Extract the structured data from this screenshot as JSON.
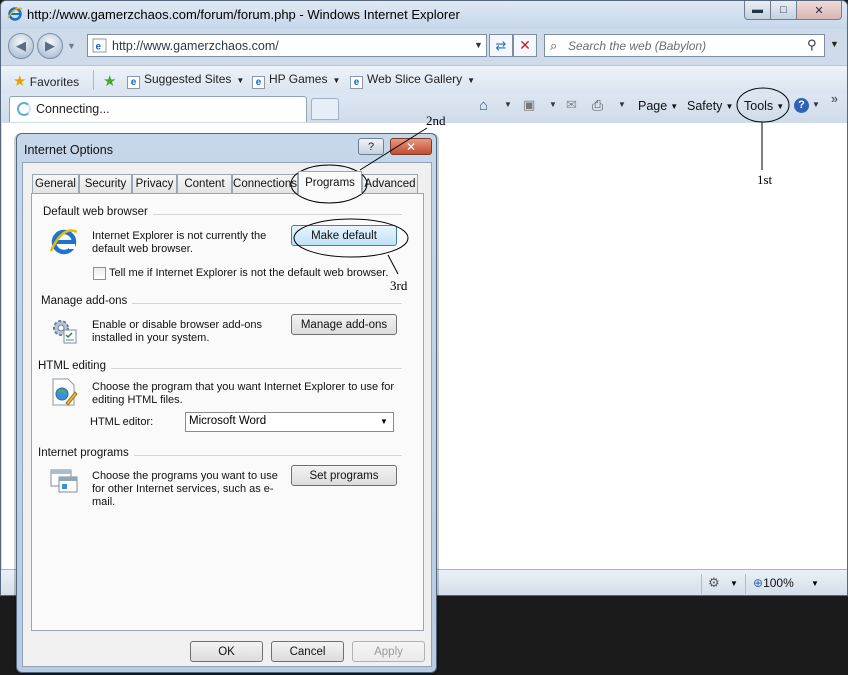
{
  "browser": {
    "title": "http://www.gamerzchaos.com/forum/forum.php - Windows Internet Explorer",
    "address": "http://www.gamerzchaos.com/",
    "search_placeholder": "Search the web (Babylon)",
    "favorites_bar": {
      "favorites": "Favorites",
      "items": [
        "Suggested Sites",
        "HP Games",
        "Web Slice Gallery"
      ]
    },
    "tab_label": "Connecting...",
    "command_bar": {
      "page": "Page",
      "safety": "Safety",
      "tools": "Tools",
      "overflow": "»"
    },
    "status_bar": {
      "zoom": "100%"
    }
  },
  "dialog": {
    "title": "Internet Options",
    "help": "?",
    "tabs": [
      "General",
      "Security",
      "Privacy",
      "Content",
      "Connections",
      "Programs",
      "Advanced"
    ],
    "selected_tab": "Programs",
    "default_browser": {
      "group": "Default web browser",
      "text": "Internet Explorer is not currently the default web browser.",
      "button": "Make default",
      "checkbox": "Tell me if Internet Explorer is not the default web browser.",
      "checkbox_checked": false
    },
    "addons": {
      "group": "Manage add-ons",
      "text": "Enable or disable browser add-ons installed in your system.",
      "button": "Manage add-ons"
    },
    "html_editing": {
      "group": "HTML editing",
      "text": "Choose the program that you want Internet Explorer to use for editing HTML files.",
      "editor_label": "HTML editor:",
      "editor_value": "Microsoft Word"
    },
    "programs": {
      "group": "Internet programs",
      "text": "Choose the programs you want to use for other Internet services, such as e-mail.",
      "button": "Set programs"
    },
    "footer": {
      "ok": "OK",
      "cancel": "Cancel",
      "apply": "Apply"
    }
  },
  "annotations": {
    "first": "1st",
    "second": "2nd",
    "third": "3rd"
  },
  "colors": {
    "chrome": "#cfdbe9",
    "dialog_frame": "#b7cce2",
    "accent_button": "#bfe2f8",
    "close_red": "#c24c2e"
  }
}
